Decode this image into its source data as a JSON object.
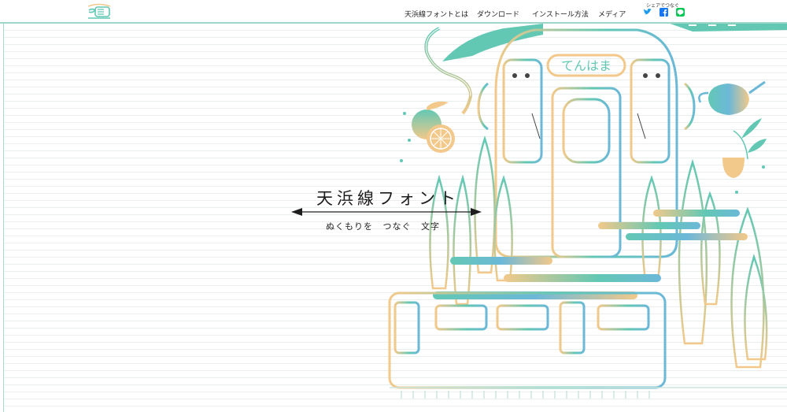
{
  "header": {
    "nav": [
      {
        "label": "天浜線フォントとは"
      },
      {
        "label": "ダウンロード"
      },
      {
        "label": "インストール方法"
      },
      {
        "label": "メディア"
      }
    ],
    "share": {
      "caption": "シェアでつなぐ",
      "icons": [
        "twitter-icon",
        "facebook-icon",
        "line-icon"
      ]
    }
  },
  "hero": {
    "title": "天浜線フォント",
    "subtitle": "ぬくもりを つなぐ 文字",
    "train_sign": "てんはま"
  },
  "colors": {
    "teal": "#62c8b4",
    "sand": "#f2c98a",
    "blue": "#6cb8d8",
    "header_rule": "#9ed7c9"
  }
}
